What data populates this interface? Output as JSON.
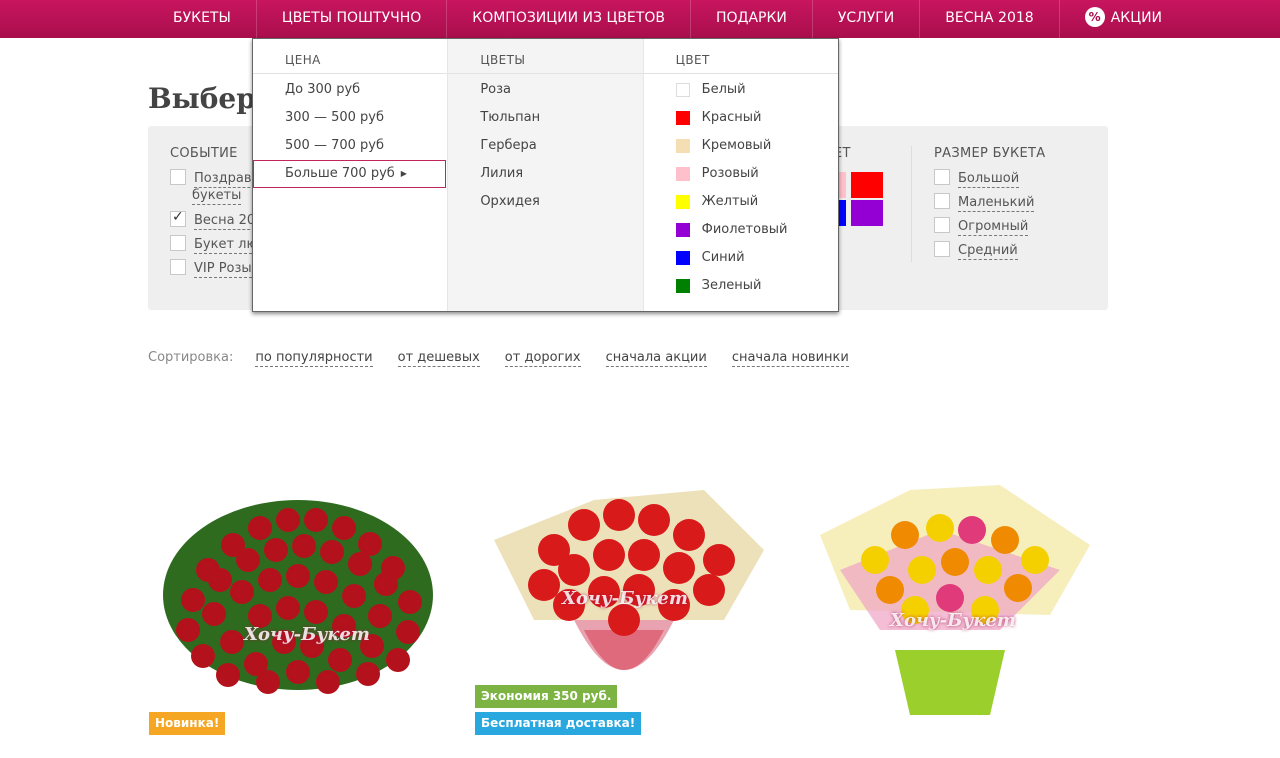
{
  "nav": {
    "items": [
      "БУКЕТЫ",
      "ЦВЕТЫ ПОШТУЧНО",
      "КОМПОЗИЦИИ ИЗ ЦВЕТОВ",
      "ПОДАРКИ",
      "УСЛУГИ",
      "ВЕСНА 2018"
    ],
    "promo_label": "АКЦИИ",
    "promo_icon": "percent-icon"
  },
  "page": {
    "title_visible": "Выбери"
  },
  "filters": {
    "event": {
      "title": "СОБЫТИЕ",
      "items": [
        {
          "label": "Поздрави",
          "label2": "букеты",
          "checked": false
        },
        {
          "label": "Весна 20",
          "checked": true
        },
        {
          "label": "Букет лю",
          "checked": false
        },
        {
          "label": "VIP Розы",
          "checked": false
        }
      ]
    },
    "color_title_visible": "ЕТ",
    "size": {
      "title": "РАЗМЕР БУКЕТА",
      "items": [
        "Большой",
        "Маленький",
        "Огромный",
        "Средний"
      ]
    },
    "visible_swatch_colors": [
      "#ffc0cb",
      "#ff0000",
      "#0000ff",
      "#9400d3"
    ]
  },
  "dropdown": {
    "price": {
      "title": "ЦЕНА",
      "items": [
        "До 300 руб",
        "300 — 500 руб",
        "500 — 700 руб",
        "Больше 700 руб"
      ]
    },
    "flowers": {
      "title": "ЦВЕТЫ",
      "items": [
        "Роза",
        "Тюльпан",
        "Гербера",
        "Лилия",
        "Орхидея"
      ]
    },
    "color": {
      "title": "ЦВЕТ",
      "items": [
        {
          "label": "Белый",
          "color": "#ffffff"
        },
        {
          "label": "Красный",
          "color": "#ff0000"
        },
        {
          "label": "Кремовый",
          "color": "#f5deb3"
        },
        {
          "label": "Розовый",
          "color": "#ffc0cb"
        },
        {
          "label": "Желтый",
          "color": "#ffff00"
        },
        {
          "label": "Фиолетовый",
          "color": "#9400d3"
        },
        {
          "label": "Синий",
          "color": "#0000ff"
        },
        {
          "label": "Зеленый",
          "color": "#008000"
        }
      ]
    }
  },
  "sort": {
    "label": "Сортировка:",
    "options": [
      "по популярности",
      "от дешевых",
      "от дорогих",
      "сначала акции",
      "сначала новинки"
    ]
  },
  "products": [
    {
      "watermark": "Хочу-Букет",
      "badges": [
        {
          "text": "Новинка!",
          "color": "#f5a623"
        }
      ]
    },
    {
      "watermark": "Хочу-Букет",
      "badges": [
        {
          "text": "Экономия 350 руб.",
          "color": "#7cb342"
        },
        {
          "text": "Бесплатная доставка!",
          "color": "#29a8e0"
        }
      ]
    },
    {
      "watermark": "Хочу-Букет",
      "badges": []
    }
  ],
  "colors": {
    "brand": "#b3104f",
    "badge_new": "#f5a623",
    "badge_save": "#7cb342",
    "badge_delivery": "#29a8e0"
  }
}
